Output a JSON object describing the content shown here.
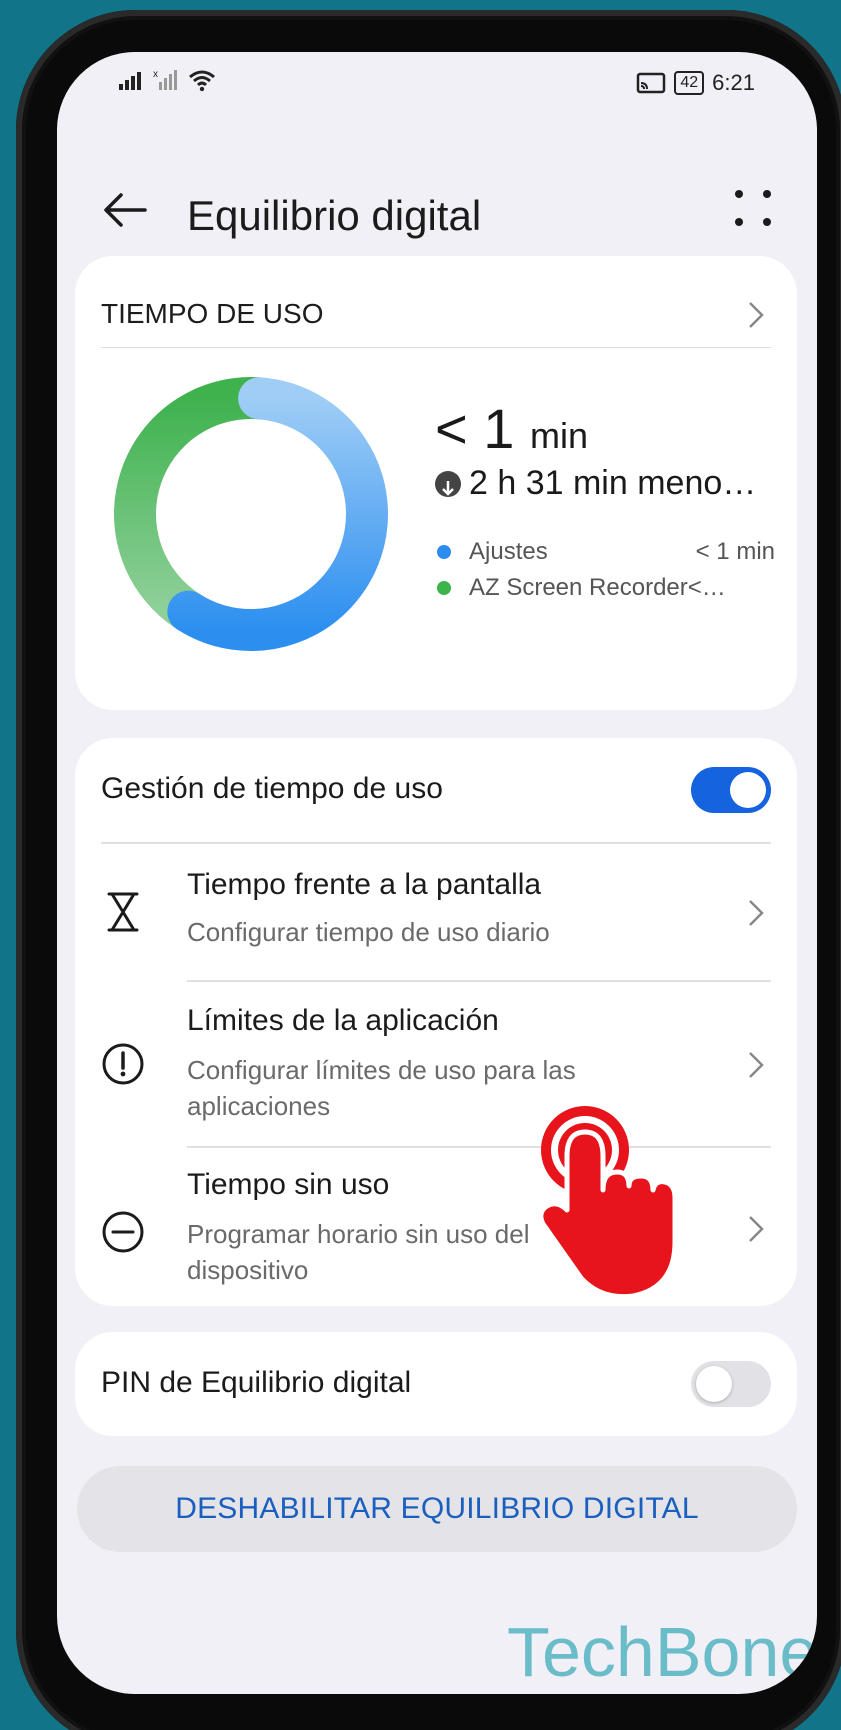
{
  "status_bar": {
    "battery": "42",
    "time": "6:21"
  },
  "header": {
    "title": "Equilibrio digital"
  },
  "usage_card": {
    "title": "TIEMPO DE USO",
    "total_value": "< 1",
    "total_unit": "min",
    "comparison": "2 h 31 min meno…",
    "legend": [
      {
        "name": "Ajustes",
        "value": "< 1 min",
        "color": "#2d8cf0"
      },
      {
        "name": "AZ Screen Recorder<…",
        "value": "",
        "color": "#3cb44a"
      }
    ],
    "chart_data": {
      "type": "pie",
      "categories": [
        "Ajustes",
        "AZ Screen Recorder"
      ],
      "values": [
        58,
        42
      ],
      "colors": [
        "#4aa3f2",
        "#4cb65a"
      ]
    }
  },
  "management_card": {
    "toggle_label": "Gestión de tiempo de uso",
    "toggle_on": true,
    "items": [
      {
        "title": "Tiempo frente a la pantalla",
        "subtitle": "Configurar tiempo de uso diario",
        "icon": "hourglass-icon"
      },
      {
        "title": "Límites de la aplicación",
        "subtitle": "Configurar límites de uso para las aplicaciones",
        "icon": "alert-circle-icon"
      },
      {
        "title": "Tiempo sin uso",
        "subtitle": "Programar horario sin uso del dispositivo",
        "icon": "minus-circle-icon"
      }
    ]
  },
  "pin_card": {
    "label": "PIN de Equilibrio digital",
    "toggle_on": false
  },
  "disable_button": {
    "label": "DESHABILITAR EQUILIBRIO DIGITAL"
  },
  "watermark": "TechBone",
  "colors": {
    "accent": "#1a5fc0",
    "toggle_on": "#1663e0",
    "tap_hand": "#e8141b"
  }
}
